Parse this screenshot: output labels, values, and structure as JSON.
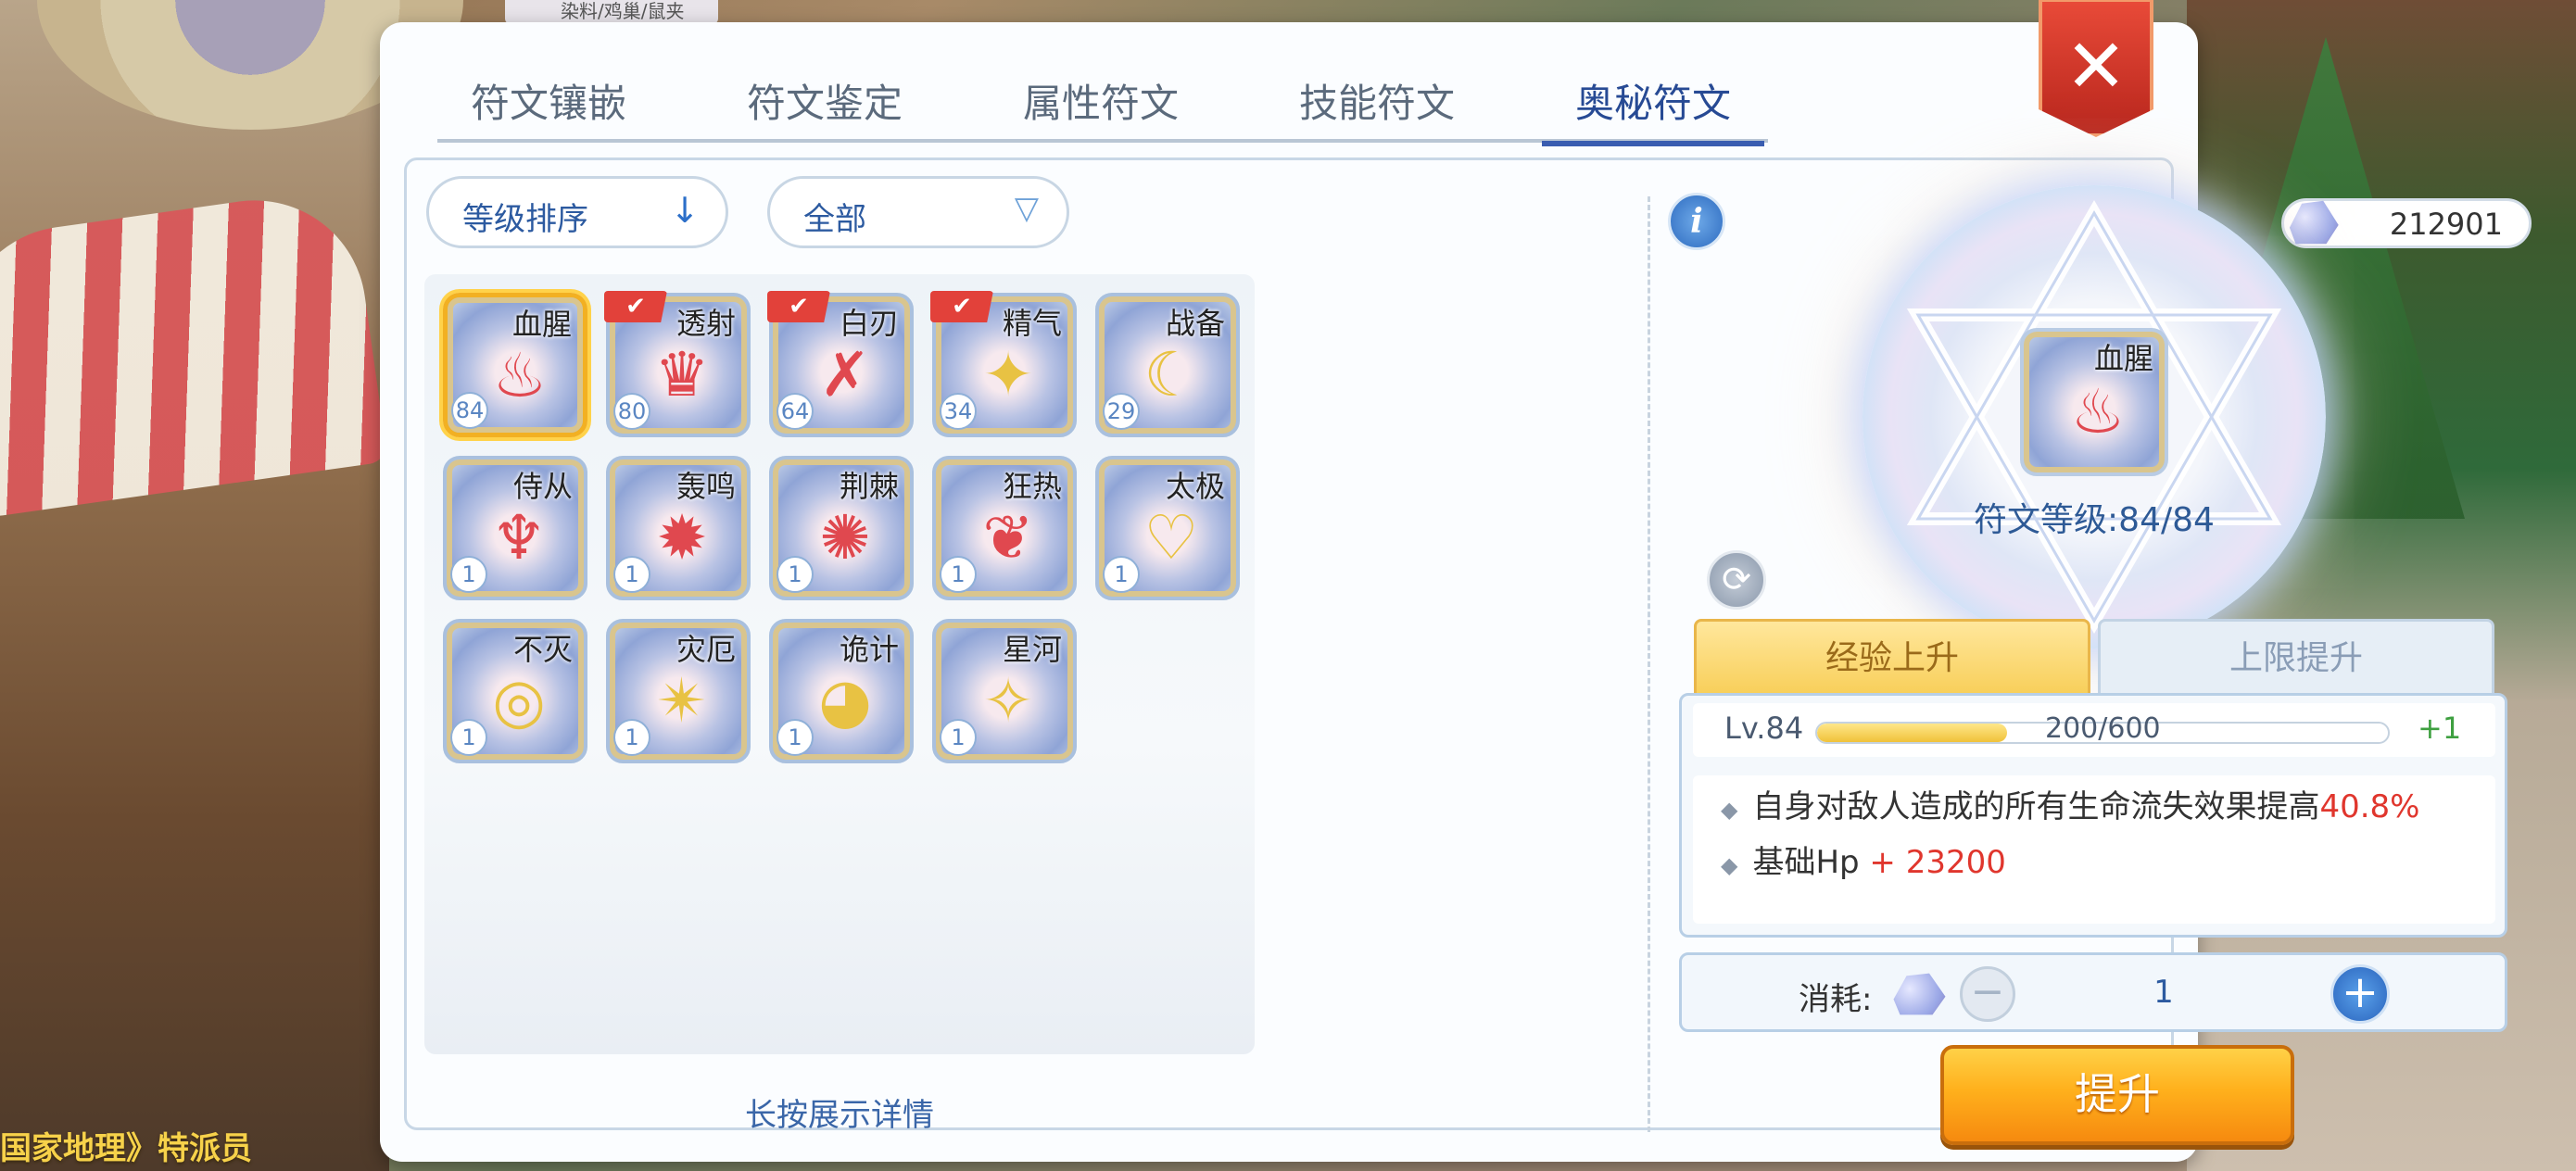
{
  "background": {
    "top_tag": "染料/鸡巢/鼠夹",
    "bottom_text": "国家地理》特派员"
  },
  "tabs": [
    {
      "label": "符文镶嵌",
      "active": false
    },
    {
      "label": "符文鉴定",
      "active": false
    },
    {
      "label": "属性符文",
      "active": false
    },
    {
      "label": "技能符文",
      "active": false
    },
    {
      "label": "奥秘符文",
      "active": true
    }
  ],
  "close_icon": "✕",
  "sort": {
    "label": "等级排序",
    "arrow": "↓"
  },
  "filter": {
    "label": "全部",
    "arrow": "▽"
  },
  "runes": [
    {
      "name": "血腥",
      "level": "84",
      "glyph": "♨",
      "gold": false,
      "selected": true,
      "equipped": false
    },
    {
      "name": "透射",
      "level": "80",
      "glyph": "♛",
      "gold": false,
      "selected": false,
      "equipped": true
    },
    {
      "name": "白刃",
      "level": "64",
      "glyph": "✗",
      "gold": false,
      "selected": false,
      "equipped": true
    },
    {
      "name": "精气",
      "level": "34",
      "glyph": "✦",
      "gold": true,
      "selected": false,
      "equipped": true
    },
    {
      "name": "战备",
      "level": "29",
      "glyph": "☾",
      "gold": true,
      "selected": false,
      "equipped": false
    },
    {
      "name": "侍从",
      "level": "1",
      "glyph": "♆",
      "gold": false,
      "selected": false,
      "equipped": false
    },
    {
      "name": "轰鸣",
      "level": "1",
      "glyph": "✹",
      "gold": false,
      "selected": false,
      "equipped": false
    },
    {
      "name": "荆棘",
      "level": "1",
      "glyph": "✺",
      "gold": false,
      "selected": false,
      "equipped": false
    },
    {
      "name": "狂热",
      "level": "1",
      "glyph": "❦",
      "gold": false,
      "selected": false,
      "equipped": false
    },
    {
      "name": "太极",
      "level": "1",
      "glyph": "♡",
      "gold": true,
      "selected": false,
      "equipped": false
    },
    {
      "name": "不灭",
      "level": "1",
      "glyph": "◎",
      "gold": true,
      "selected": false,
      "equipped": false
    },
    {
      "name": "灾厄",
      "level": "1",
      "glyph": "✴",
      "gold": true,
      "selected": false,
      "equipped": false
    },
    {
      "name": "诡计",
      "level": "1",
      "glyph": "◕",
      "gold": true,
      "selected": false,
      "equipped": false
    },
    {
      "name": "星河",
      "level": "1",
      "glyph": "✧",
      "gold": true,
      "selected": false,
      "equipped": false
    }
  ],
  "equipped_mark": "✔",
  "hint": "长按展示详情",
  "info_icon": "i",
  "refresh_icon": "⟳",
  "currency": {
    "value": "212901"
  },
  "selected_rune": {
    "name": "血腥",
    "glyph": "♨",
    "level_text": "符文等级:84/84"
  },
  "sub_tabs": {
    "exp": "经验上升",
    "cap": "上限提升"
  },
  "level_row": {
    "label": "Lv.84",
    "progress_text": "200/600",
    "progress": 0.333,
    "plus": "+1"
  },
  "effects": [
    {
      "text": "自身对敌人造成的所有生命流失效果提高",
      "highlight": "40.8%"
    },
    {
      "text": "基础Hp",
      "highlight": " + 23200"
    }
  ],
  "effect_bullet": "◆",
  "cost": {
    "label": "消耗:",
    "minus": "−",
    "quantity": "1",
    "plus": "+"
  },
  "upgrade_label": "提升"
}
